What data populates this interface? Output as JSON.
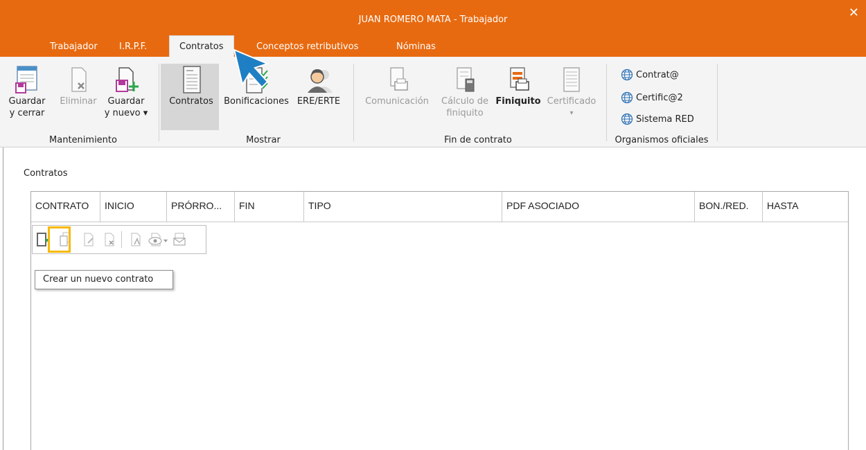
{
  "window": {
    "title": "JUAN ROMERO MATA - Trabajador",
    "close_glyph": "✕"
  },
  "tabs": [
    {
      "label": "Trabajador"
    },
    {
      "label": "I.R.P.F."
    },
    {
      "label": "Contratos",
      "active": true
    },
    {
      "label": "Conceptos retributivos"
    },
    {
      "label": "Nóminas"
    }
  ],
  "ribbon": {
    "groups": {
      "mantenimiento": "Mantenimiento",
      "mostrar": "Mostrar",
      "fin_contrato": "Fin de contrato",
      "organismos": "Organismos oficiales"
    },
    "buttons": {
      "guardar_cerrar": {
        "line1": "Guardar",
        "line2": "y cerrar",
        "icon": "save-close-icon"
      },
      "eliminar": {
        "line1": "Eliminar",
        "icon": "delete-document-icon",
        "enabled": false
      },
      "guardar_nuevo": {
        "line1": "Guardar",
        "line2": "y nuevo ▾",
        "icon": "save-new-icon"
      },
      "contratos": {
        "line1": "Contratos",
        "icon": "contract-document-icon",
        "selected": true
      },
      "bonificaciones": {
        "line1": "Bonificaciones",
        "icon": "bonus-checklist-icon"
      },
      "ere_erte": {
        "line1": "ERE/ERTE",
        "icon": "person-avatar-icon"
      },
      "comunicacion": {
        "line1": "Comunicación",
        "icon": "print-document-icon",
        "enabled": false
      },
      "calculo_finiquito": {
        "line1": "Cálculo de",
        "line2": "finiquito",
        "icon": "calculator-document-icon",
        "enabled": false
      },
      "finiquito": {
        "line1": "Finiquito",
        "icon": "print-settlement-icon"
      },
      "certificado": {
        "line1": "Certificado",
        "line2": "▾",
        "icon": "certificate-icon",
        "enabled": false
      }
    },
    "organismos": [
      {
        "label": "Contrat@",
        "icon": "globe-icon"
      },
      {
        "label": "Certific@2",
        "icon": "globe-icon"
      },
      {
        "label": "Sistema RED",
        "icon": "globe-icon"
      }
    ]
  },
  "content": {
    "section_title": "Contratos",
    "columns": [
      "CONTRATO",
      "INICIO",
      "PRÓRRO...",
      "FIN",
      "TIPO",
      "PDF ASOCIADO",
      "BON./RED.",
      "HASTA"
    ],
    "tooltip": "Crear un nuevo contrato",
    "toolbar_icons": [
      "new-record-icon",
      "copy-icon",
      "edit-icon",
      "delete-icon",
      "pdf-attach-icon",
      "preview-icon",
      "email-icon"
    ]
  },
  "colors": {
    "accent": "#e86a10",
    "highlight": "#f7b800",
    "cursor": "#1f7fc4"
  }
}
